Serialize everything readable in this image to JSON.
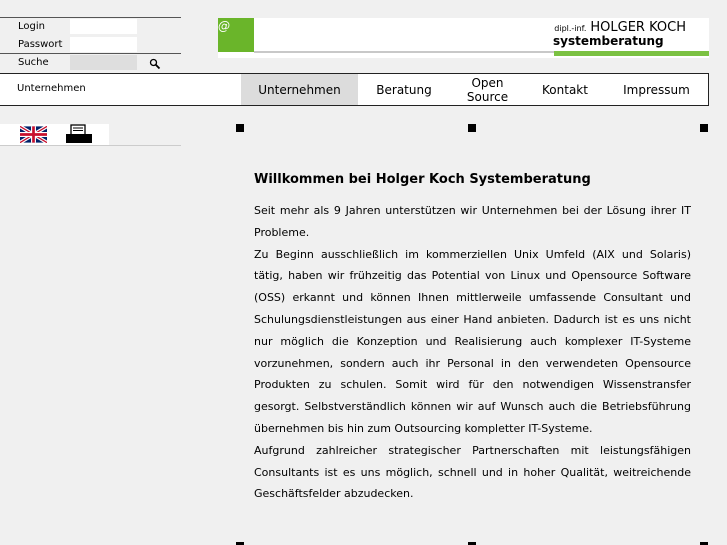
{
  "login": {
    "user_label": "Login",
    "password_label": "Passwort",
    "search_label": "Suche",
    "user_value": "",
    "password_value": "",
    "search_value": ""
  },
  "brand": {
    "prefix": "dipl.-inf.",
    "name": "HOLGER KOCH",
    "sub": "systemberatung",
    "logo_glyph": "@",
    "accent": "#7bc142"
  },
  "breadcrumb": "Unternehmen",
  "nav": [
    {
      "label": "Unternehmen",
      "active": true
    },
    {
      "label": "Beratung",
      "active": false
    },
    {
      "label": "Open Source",
      "active": false
    },
    {
      "label": "Kontakt",
      "active": false
    },
    {
      "label": "Impressum",
      "active": false
    }
  ],
  "icons": {
    "language": "uk-flag-icon",
    "print": "printer-icon",
    "search": "magnifier-icon"
  },
  "content": {
    "title": "Willkommen bei Holger Koch Systemberatung",
    "paragraphs": [
      "Seit mehr als 9 Jahren unterstützen wir Unternehmen bei der Lösung ihrer IT Probleme.",
      "Zu Beginn ausschließlich im kommerziellen Unix Umfeld (AIX und Solaris) tätig, haben wir frühzeitig das Potential von Linux und Opensource Software (OSS) erkannt und können Ihnen mittlerweile umfassende Consultant und Schulungsdienstleistungen aus einer Hand anbieten. Dadurch ist es uns nicht nur möglich die Konzeption und Realisierung auch komplexer IT-Systeme vorzunehmen, sondern auch ihr Personal in den verwendeten Opensource Produkten zu schulen. Somit wird für den notwendigen Wissenstransfer gesorgt. Selbstverständlich können wir auf Wunsch auch die Betriebsführung übernehmen bis hin zum Outsourcing kompletter IT-Systeme.",
      "Aufgrund zahlreicher strategischer Partnerschaften mit leistungsfähigen Consultants ist es uns möglich, schnell und in hoher Qualität, weitreichende Geschäftsfelder abzudecken."
    ]
  }
}
